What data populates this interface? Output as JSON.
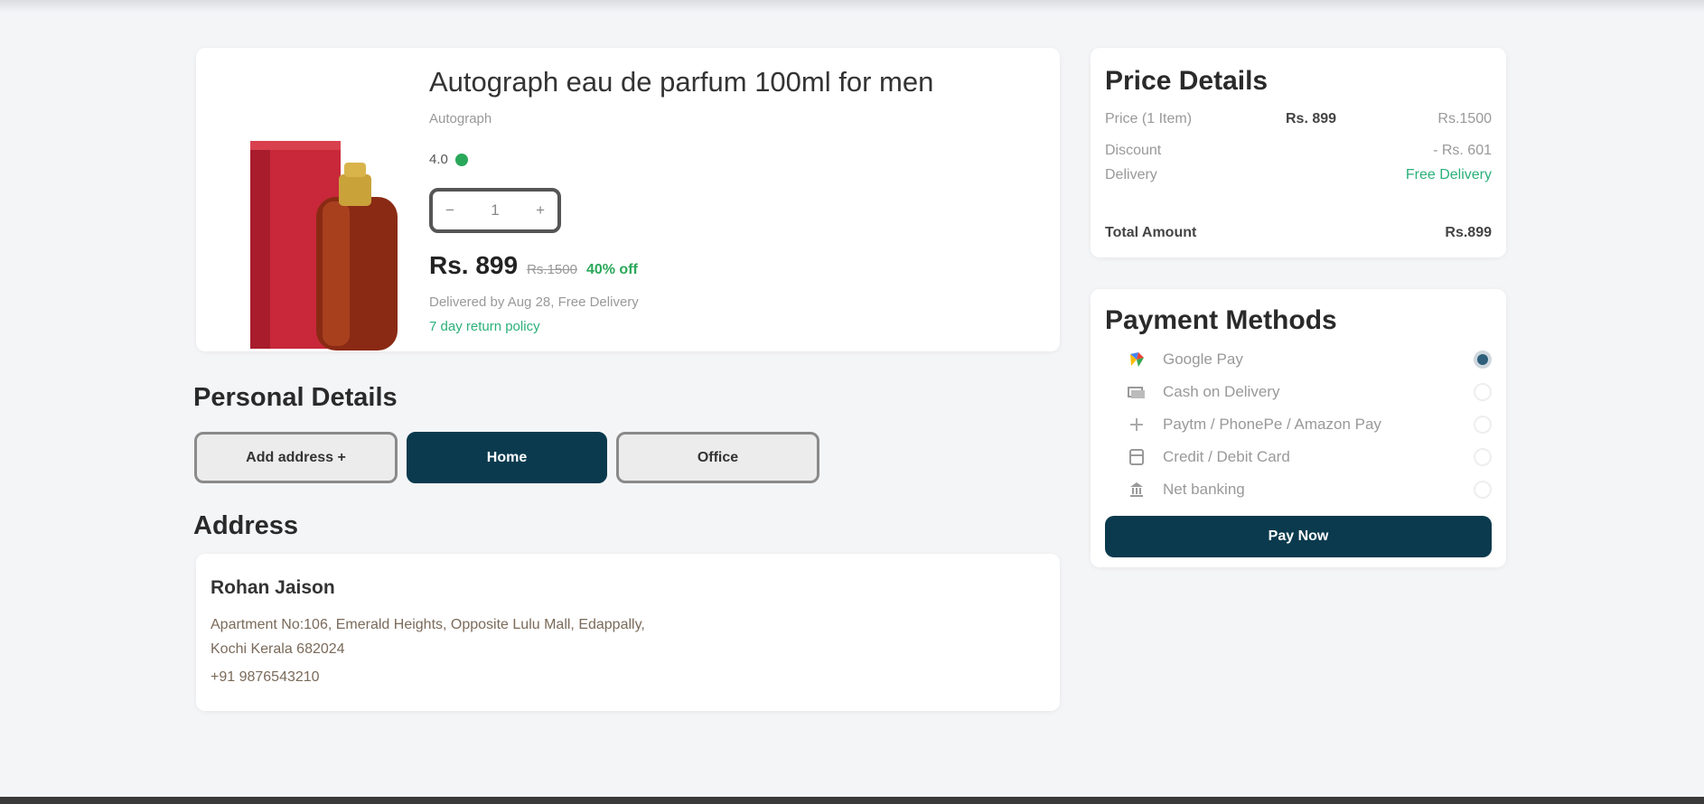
{
  "product": {
    "title": "Autograph eau de parfum 100ml for men",
    "brand": "Autograph",
    "rating": "4.0",
    "quantity": "1",
    "qty_minus": "−",
    "qty_plus": "+",
    "price": "Rs. 899",
    "mrp": "Rs.1500",
    "discount": "40% off",
    "delivery": "Delivered by Aug 28, Free Delivery",
    "return_policy": "7 day return policy"
  },
  "personal_details": {
    "title": "Personal Details",
    "add_address": "Add address +",
    "home": "Home",
    "office": "Office"
  },
  "address": {
    "title": "Address",
    "name": "Rohan Jaison",
    "line1": "Apartment No:106, Emerald Heights, Opposite Lulu Mall, Edappally,",
    "line2": "Kochi Kerala 682024",
    "phone": "+91 9876543210"
  },
  "price_details": {
    "title": "Price Details",
    "price_label": "Price (1 Item)",
    "price_mid": "Rs. 899",
    "price_value": "Rs.1500",
    "discount_label": "Discount",
    "discount_value": "- Rs. 601",
    "delivery_label": "Delivery",
    "delivery_value": "Free Delivery",
    "total_label": "Total Amount",
    "total_value": "Rs.899"
  },
  "payment": {
    "title": "Payment Methods",
    "methods": [
      {
        "label": "Google Pay",
        "icon": "google-pay-icon"
      },
      {
        "label": "Cash on Delivery",
        "icon": "cash-icon"
      },
      {
        "label": "Paytm / PhonePe / Amazon Pay",
        "icon": "wallet-icon"
      },
      {
        "label": "Credit / Debit Card",
        "icon": "card-icon"
      },
      {
        "label": "Net banking",
        "icon": "bank-icon"
      }
    ],
    "selected": "Google Pay",
    "pay_button": "Pay Now"
  },
  "colors": {
    "accent": "#0b3a4e",
    "success": "#2aa85a",
    "background": "#f4f5f7"
  }
}
